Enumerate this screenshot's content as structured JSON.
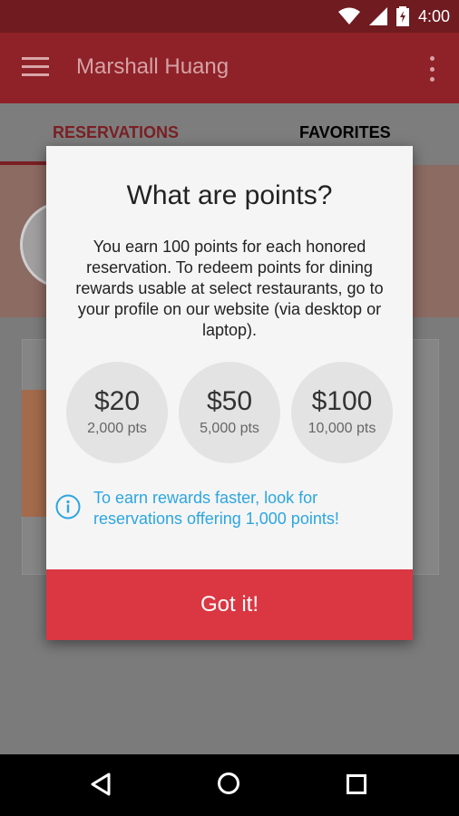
{
  "status_bar": {
    "time": "4:00",
    "icons": [
      "wifi-icon",
      "signal-icon",
      "battery-charging-icon"
    ]
  },
  "app_bar": {
    "title": "Marshall Huang",
    "menu_icon": "hamburger-menu-icon",
    "overflow_icon": "more-vert-icon"
  },
  "tabs": [
    {
      "label": "RESERVATIONS",
      "selected": true
    },
    {
      "label": "FAVORITES",
      "selected": false
    }
  ],
  "dialog": {
    "title": "What are points?",
    "body": "You earn 100 points for each honored reservation. To redeem points for dining rewards usable at select restaurants, go to your profile on our website (via desktop or laptop).",
    "rewards": [
      {
        "amount": "$20",
        "points": "2,000 pts"
      },
      {
        "amount": "$50",
        "points": "5,000 pts"
      },
      {
        "amount": "$100",
        "points": "10,000 pts"
      }
    ],
    "tip": "To earn rewards faster, look for reservations offering 1,000 points!",
    "button_label": "Got it!"
  },
  "colors": {
    "accent_red": "#da3743",
    "info_blue": "#2ca6e0",
    "dialog_bg": "#f5f5f5"
  },
  "nav_bar": {
    "icons": [
      "back-icon",
      "home-icon",
      "recents-icon"
    ]
  }
}
